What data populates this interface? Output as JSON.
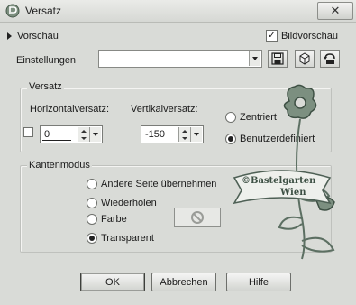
{
  "window": {
    "title": "Versatz",
    "close_label": "✕"
  },
  "preview": {
    "label": "Vorschau",
    "bildvorschau_label": "Bildvorschau",
    "bildvorschau_checked": true,
    "check_glyph": "✓"
  },
  "settings": {
    "label": "Einstellungen",
    "value": ""
  },
  "offset_group": {
    "title": "Versatz",
    "horizontal_label": "Horizontalversatz:",
    "horizontal_value": "0",
    "vertical_label": "Vertikalversatz:",
    "vertical_value": "-150",
    "radio_centered": "Zentriert",
    "radio_custom": "Benutzerdefiniert",
    "selected": "Benutzerdefiniert"
  },
  "edge_group": {
    "title": "Kantenmodus",
    "options": [
      "Andere Seite übernehmen",
      "Wiederholen",
      "Farbe",
      "Transparent"
    ],
    "selected": "Transparent"
  },
  "watermark": {
    "line1": "©Bastelgarten",
    "line2": "Wien"
  },
  "buttons": {
    "ok": "OK",
    "cancel": "Abbrechen",
    "help": "Hilfe"
  },
  "icons": [
    "app-icon",
    "close-icon",
    "save-icon",
    "delete-icon",
    "reset-icon",
    "no-color-icon",
    "chevron-down-icon",
    "spinner-up-icon",
    "spinner-down-icon"
  ]
}
